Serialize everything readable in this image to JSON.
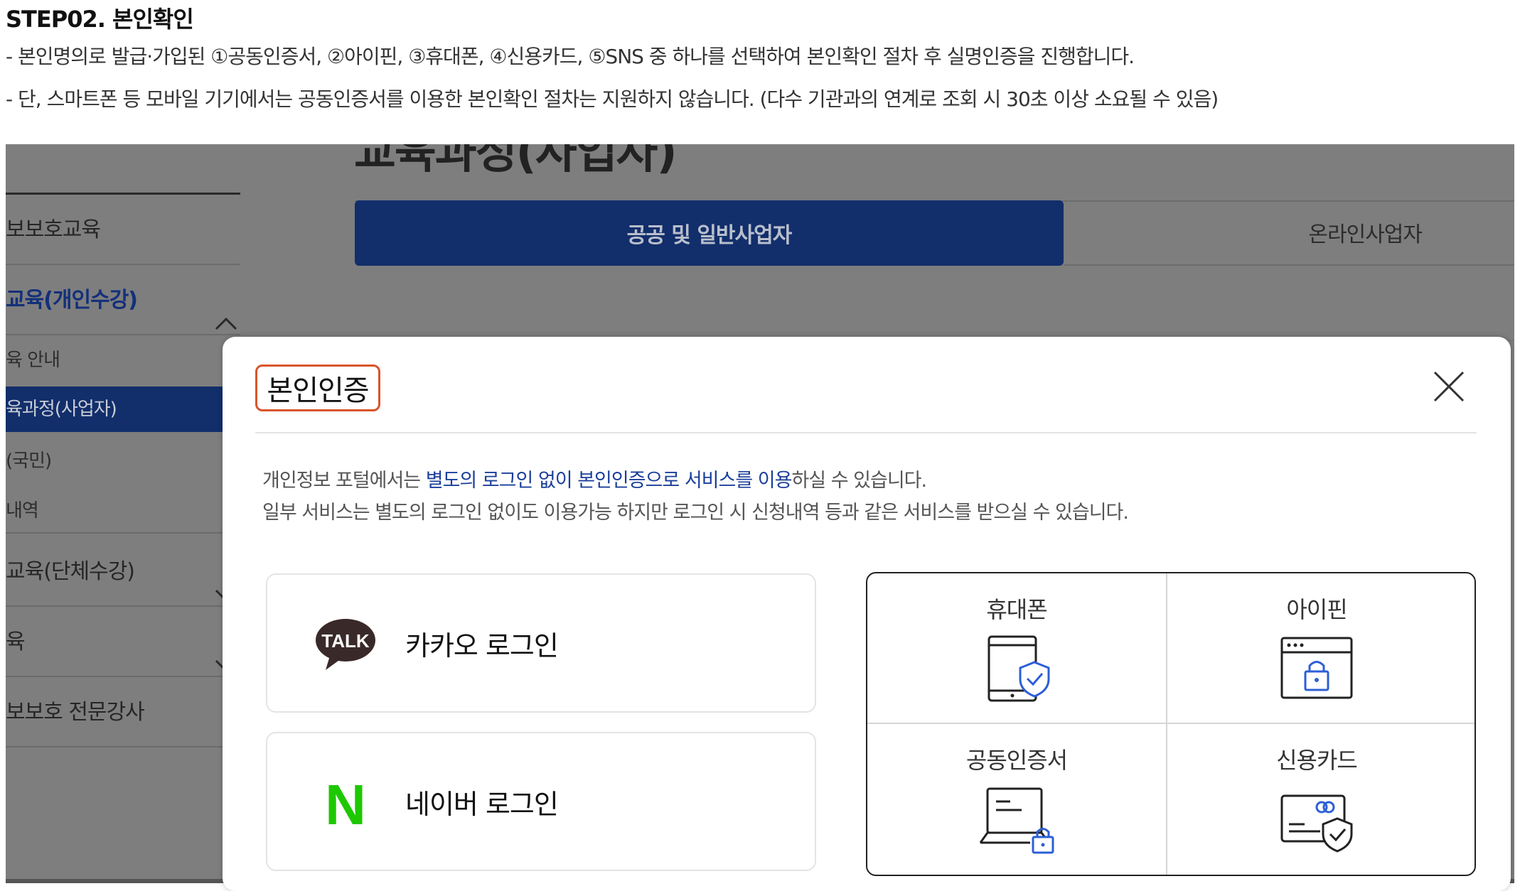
{
  "guide": {
    "title": "STEP02. 본인확인",
    "line1": "- 본인명의로 발급·가입된 ①공동인증서, ②아이핀, ③휴대폰, ④신용카드, ⑤SNS 중 하나를 선택하여 본인확인 절차 후 실명인증을 진행합니다.",
    "line2": "- 단, 스마트폰 등 모바일 기기에서는 공동인증서를 이용한 본인확인 절차는 지원하지 않습니다. (다수 기관과의 연계로 조회 시 30초 이상 소요될 수 있음)"
  },
  "background": {
    "page_heading": "교육과정(사업자)",
    "sidebar": {
      "items": [
        {
          "label": "보보호교육"
        },
        {
          "label": "교육(개인수강)"
        },
        {
          "label": "육 안내"
        },
        {
          "label": "육과정(사업자)"
        },
        {
          "label": "(국민)"
        },
        {
          "label": "내역"
        },
        {
          "label": "교육(단체수강)"
        },
        {
          "label": "육"
        },
        {
          "label": "보보호 전문강사"
        }
      ]
    },
    "tabs": [
      {
        "label": "공공 및 일반사업자"
      },
      {
        "label": "온라인사업자"
      }
    ]
  },
  "modal": {
    "title": "본인인증",
    "desc_line1_prefix": "개인정보 포털에서는 ",
    "desc_line1_highlight": "별도의 로그인 없이 본인인증으로 서비스를 이용",
    "desc_line1_suffix": "하실 수 있습니다.",
    "desc_line2": "일부 서비스는 별도의 로그인 없이도 이용가능 하지만 로그인 시 신청내역 등과 같은 서비스를 받으실 수 있습니다.",
    "login_options": [
      {
        "label": "카카오 로그인",
        "icon_text": "TALK",
        "icon": "kakao-talk-icon"
      },
      {
        "label": "네이버 로그인",
        "icon_text": "N",
        "icon": "naver-n-icon"
      }
    ],
    "auth_options": [
      {
        "label": "휴대폰",
        "icon": "phone-shield-icon"
      },
      {
        "label": "아이핀",
        "icon": "ipin-lock-icon"
      },
      {
        "label": "공동인증서",
        "icon": "laptop-lock-icon"
      },
      {
        "label": "신용카드",
        "icon": "card-shield-icon"
      }
    ]
  },
  "colors": {
    "navy": "#122e6b",
    "highlight_blue": "#1b3f9a",
    "title_border": "#d9542a",
    "kakao_bubble": "#3a2929",
    "naver_green": "#1ec800",
    "icon_blue": "#2c5fd6"
  }
}
